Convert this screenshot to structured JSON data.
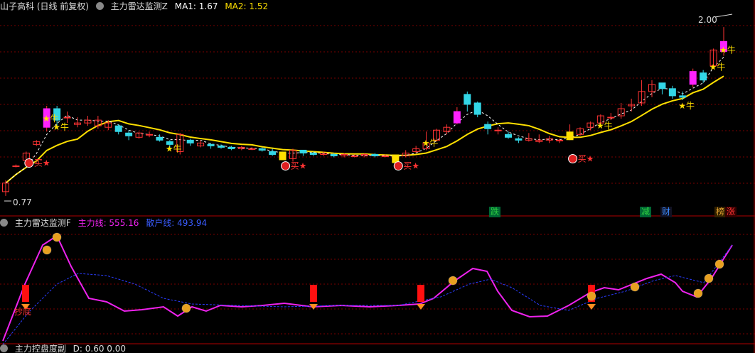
{
  "main_panel": {
    "title": "山子高科 (日线 前复权)",
    "indicator": "主力雷达监测Z",
    "ma1_label": "MA1: 1.67",
    "ma2_label": "MA2: 1.52",
    "price_high": "2.00",
    "price_low": "0.77",
    "labels": {
      "buy": "买",
      "bull": "牛"
    },
    "signals": [
      {
        "text": "跌",
        "color": "#2ecc40"
      },
      {
        "text": "减",
        "color": "#2ecc40"
      },
      {
        "text": "财",
        "color": "#3a8cff"
      },
      {
        "text": "榜",
        "color": "#e0a030"
      },
      {
        "text": "涨",
        "color": "#ff3333"
      }
    ]
  },
  "sub_panel": {
    "indicator": "主力雷达监测F",
    "main_line_label": "主力线: 555.16",
    "retail_line_label": "散户线: 493.94",
    "start_label": "抄底"
  },
  "bottom_panel": {
    "indicator_partial": "主力控盘度副",
    "value_partial": "D: 0.60  0.00"
  },
  "colors": {
    "up": "#ff3333",
    "down": "#33d6e6",
    "ma_long": "#ffe000",
    "ma_short": "#ffffff",
    "main_line": "#ee22ee",
    "retail_line": "#2a3cff",
    "grid": "#7a0000",
    "text": "#cccccc"
  },
  "chart_data": [
    {
      "type": "candlestick",
      "title": "山子高科 (日线 前复权)",
      "price_range": [
        0.77,
        2.0
      ],
      "series": [
        {
          "name": "MA1",
          "last": 1.67
        },
        {
          "name": "MA2",
          "last": 1.52
        }
      ],
      "bars": [
        [
          0.8,
          0.86,
          0.77,
          0.88
        ],
        [
          0.98,
          0.98,
          0.97,
          0.99
        ],
        [
          1.02,
          1.07,
          1.01,
          1.08
        ],
        [
          1.13,
          1.15,
          1.12,
          1.16
        ],
        [
          1.25,
          1.38,
          1.22,
          1.4
        ],
        [
          1.38,
          1.3,
          1.25,
          1.4
        ],
        [
          1.32,
          1.32,
          1.28,
          1.36
        ],
        [
          1.27,
          1.28,
          1.25,
          1.32
        ],
        [
          1.28,
          1.3,
          1.26,
          1.33
        ],
        [
          1.26,
          1.3,
          1.24,
          1.33
        ],
        [
          1.25,
          1.28,
          1.23,
          1.3
        ],
        [
          1.26,
          1.22,
          1.2,
          1.27
        ],
        [
          1.21,
          1.19,
          1.16,
          1.23
        ],
        [
          1.18,
          1.21,
          1.17,
          1.22
        ],
        [
          1.2,
          1.2,
          1.18,
          1.22
        ],
        [
          1.18,
          1.16,
          1.15,
          1.2
        ],
        [
          1.15,
          1.13,
          1.1,
          1.16
        ],
        [
          1.08,
          1.2,
          1.06,
          1.21
        ],
        [
          1.16,
          1.14,
          1.12,
          1.17
        ],
        [
          1.12,
          1.14,
          1.11,
          1.16
        ],
        [
          1.13,
          1.12,
          1.1,
          1.14
        ],
        [
          1.12,
          1.11,
          1.1,
          1.13
        ],
        [
          1.11,
          1.1,
          1.09,
          1.12
        ],
        [
          1.1,
          1.11,
          1.09,
          1.12
        ],
        [
          1.1,
          1.1,
          1.09,
          1.11
        ],
        [
          1.1,
          1.09,
          1.08,
          1.11
        ],
        [
          1.08,
          1.06,
          1.05,
          1.1
        ],
        [
          1.06,
          1.06,
          1.03,
          1.08
        ],
        [
          1.03,
          1.09,
          1.01,
          1.1
        ],
        [
          1.09,
          1.07,
          1.05,
          1.09
        ],
        [
          1.07,
          1.06,
          1.05,
          1.08
        ],
        [
          1.06,
          1.07,
          1.05,
          1.08
        ],
        [
          1.06,
          1.05,
          1.04,
          1.07
        ],
        [
          1.05,
          1.06,
          1.04,
          1.07
        ],
        [
          1.05,
          1.05,
          1.04,
          1.06
        ],
        [
          1.05,
          1.06,
          1.04,
          1.07
        ],
        [
          1.06,
          1.05,
          1.04,
          1.07
        ],
        [
          1.05,
          1.05,
          1.04,
          1.06
        ],
        [
          1.04,
          1.04,
          1.03,
          1.05
        ],
        [
          1.05,
          1.07,
          1.04,
          1.09
        ],
        [
          1.08,
          1.1,
          1.07,
          1.12
        ],
        [
          1.1,
          1.14,
          1.09,
          1.22
        ],
        [
          1.16,
          1.23,
          1.15,
          1.24
        ],
        [
          1.22,
          1.25,
          1.2,
          1.27
        ],
        [
          1.28,
          1.36,
          1.27,
          1.39
        ],
        [
          1.48,
          1.41,
          1.36,
          1.5
        ],
        [
          1.42,
          1.34,
          1.32,
          1.43
        ],
        [
          1.27,
          1.24,
          1.2,
          1.29
        ],
        [
          1.23,
          1.23,
          1.2,
          1.25
        ],
        [
          1.2,
          1.18,
          1.17,
          1.22
        ],
        [
          1.17,
          1.16,
          1.14,
          1.18
        ],
        [
          1.16,
          1.17,
          1.15,
          1.21
        ],
        [
          1.15,
          1.16,
          1.14,
          1.2
        ],
        [
          1.16,
          1.17,
          1.14,
          1.19
        ],
        [
          1.16,
          1.16,
          1.14,
          1.17
        ],
        [
          1.17,
          1.2,
          1.16,
          1.27
        ],
        [
          1.2,
          1.24,
          1.19,
          1.25
        ],
        [
          1.25,
          1.28,
          1.23,
          1.29
        ],
        [
          1.28,
          1.33,
          1.27,
          1.34
        ],
        [
          1.32,
          1.32,
          1.3,
          1.35
        ],
        [
          1.33,
          1.38,
          1.31,
          1.42
        ],
        [
          1.4,
          1.41,
          1.36,
          1.45
        ],
        [
          1.42,
          1.5,
          1.4,
          1.58
        ],
        [
          1.5,
          1.55,
          1.46,
          1.58
        ],
        [
          1.56,
          1.52,
          1.48,
          1.56
        ],
        [
          1.52,
          1.47,
          1.45,
          1.54
        ],
        [
          1.47,
          1.46,
          1.44,
          1.5
        ],
        [
          1.55,
          1.64,
          1.53,
          1.66
        ],
        [
          1.63,
          1.58,
          1.56,
          1.65
        ],
        [
          1.68,
          1.79,
          1.66,
          1.8
        ],
        [
          1.78,
          1.85,
          1.75,
          1.95
        ]
      ]
    },
    {
      "type": "line",
      "title": "主力雷达监测F",
      "series": [
        {
          "name": "主力线",
          "last": 555.16
        },
        {
          "name": "散户线",
          "last": 493.94
        }
      ]
    }
  ]
}
